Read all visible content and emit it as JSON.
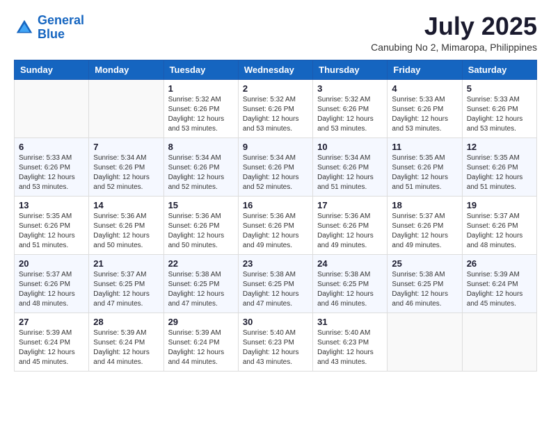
{
  "header": {
    "logo_line1": "General",
    "logo_line2": "Blue",
    "month_year": "July 2025",
    "location": "Canubing No 2, Mimaropa, Philippines"
  },
  "weekdays": [
    "Sunday",
    "Monday",
    "Tuesday",
    "Wednesday",
    "Thursday",
    "Friday",
    "Saturday"
  ],
  "weeks": [
    [
      {
        "day": "",
        "sunrise": "",
        "sunset": "",
        "daylight": ""
      },
      {
        "day": "",
        "sunrise": "",
        "sunset": "",
        "daylight": ""
      },
      {
        "day": "1",
        "sunrise": "Sunrise: 5:32 AM",
        "sunset": "Sunset: 6:26 PM",
        "daylight": "Daylight: 12 hours and 53 minutes."
      },
      {
        "day": "2",
        "sunrise": "Sunrise: 5:32 AM",
        "sunset": "Sunset: 6:26 PM",
        "daylight": "Daylight: 12 hours and 53 minutes."
      },
      {
        "day": "3",
        "sunrise": "Sunrise: 5:32 AM",
        "sunset": "Sunset: 6:26 PM",
        "daylight": "Daylight: 12 hours and 53 minutes."
      },
      {
        "day": "4",
        "sunrise": "Sunrise: 5:33 AM",
        "sunset": "Sunset: 6:26 PM",
        "daylight": "Daylight: 12 hours and 53 minutes."
      },
      {
        "day": "5",
        "sunrise": "Sunrise: 5:33 AM",
        "sunset": "Sunset: 6:26 PM",
        "daylight": "Daylight: 12 hours and 53 minutes."
      }
    ],
    [
      {
        "day": "6",
        "sunrise": "Sunrise: 5:33 AM",
        "sunset": "Sunset: 6:26 PM",
        "daylight": "Daylight: 12 hours and 53 minutes."
      },
      {
        "day": "7",
        "sunrise": "Sunrise: 5:34 AM",
        "sunset": "Sunset: 6:26 PM",
        "daylight": "Daylight: 12 hours and 52 minutes."
      },
      {
        "day": "8",
        "sunrise": "Sunrise: 5:34 AM",
        "sunset": "Sunset: 6:26 PM",
        "daylight": "Daylight: 12 hours and 52 minutes."
      },
      {
        "day": "9",
        "sunrise": "Sunrise: 5:34 AM",
        "sunset": "Sunset: 6:26 PM",
        "daylight": "Daylight: 12 hours and 52 minutes."
      },
      {
        "day": "10",
        "sunrise": "Sunrise: 5:34 AM",
        "sunset": "Sunset: 6:26 PM",
        "daylight": "Daylight: 12 hours and 51 minutes."
      },
      {
        "day": "11",
        "sunrise": "Sunrise: 5:35 AM",
        "sunset": "Sunset: 6:26 PM",
        "daylight": "Daylight: 12 hours and 51 minutes."
      },
      {
        "day": "12",
        "sunrise": "Sunrise: 5:35 AM",
        "sunset": "Sunset: 6:26 PM",
        "daylight": "Daylight: 12 hours and 51 minutes."
      }
    ],
    [
      {
        "day": "13",
        "sunrise": "Sunrise: 5:35 AM",
        "sunset": "Sunset: 6:26 PM",
        "daylight": "Daylight: 12 hours and 51 minutes."
      },
      {
        "day": "14",
        "sunrise": "Sunrise: 5:36 AM",
        "sunset": "Sunset: 6:26 PM",
        "daylight": "Daylight: 12 hours and 50 minutes."
      },
      {
        "day": "15",
        "sunrise": "Sunrise: 5:36 AM",
        "sunset": "Sunset: 6:26 PM",
        "daylight": "Daylight: 12 hours and 50 minutes."
      },
      {
        "day": "16",
        "sunrise": "Sunrise: 5:36 AM",
        "sunset": "Sunset: 6:26 PM",
        "daylight": "Daylight: 12 hours and 49 minutes."
      },
      {
        "day": "17",
        "sunrise": "Sunrise: 5:36 AM",
        "sunset": "Sunset: 6:26 PM",
        "daylight": "Daylight: 12 hours and 49 minutes."
      },
      {
        "day": "18",
        "sunrise": "Sunrise: 5:37 AM",
        "sunset": "Sunset: 6:26 PM",
        "daylight": "Daylight: 12 hours and 49 minutes."
      },
      {
        "day": "19",
        "sunrise": "Sunrise: 5:37 AM",
        "sunset": "Sunset: 6:26 PM",
        "daylight": "Daylight: 12 hours and 48 minutes."
      }
    ],
    [
      {
        "day": "20",
        "sunrise": "Sunrise: 5:37 AM",
        "sunset": "Sunset: 6:26 PM",
        "daylight": "Daylight: 12 hours and 48 minutes."
      },
      {
        "day": "21",
        "sunrise": "Sunrise: 5:37 AM",
        "sunset": "Sunset: 6:25 PM",
        "daylight": "Daylight: 12 hours and 47 minutes."
      },
      {
        "day": "22",
        "sunrise": "Sunrise: 5:38 AM",
        "sunset": "Sunset: 6:25 PM",
        "daylight": "Daylight: 12 hours and 47 minutes."
      },
      {
        "day": "23",
        "sunrise": "Sunrise: 5:38 AM",
        "sunset": "Sunset: 6:25 PM",
        "daylight": "Daylight: 12 hours and 47 minutes."
      },
      {
        "day": "24",
        "sunrise": "Sunrise: 5:38 AM",
        "sunset": "Sunset: 6:25 PM",
        "daylight": "Daylight: 12 hours and 46 minutes."
      },
      {
        "day": "25",
        "sunrise": "Sunrise: 5:38 AM",
        "sunset": "Sunset: 6:25 PM",
        "daylight": "Daylight: 12 hours and 46 minutes."
      },
      {
        "day": "26",
        "sunrise": "Sunrise: 5:39 AM",
        "sunset": "Sunset: 6:24 PM",
        "daylight": "Daylight: 12 hours and 45 minutes."
      }
    ],
    [
      {
        "day": "27",
        "sunrise": "Sunrise: 5:39 AM",
        "sunset": "Sunset: 6:24 PM",
        "daylight": "Daylight: 12 hours and 45 minutes."
      },
      {
        "day": "28",
        "sunrise": "Sunrise: 5:39 AM",
        "sunset": "Sunset: 6:24 PM",
        "daylight": "Daylight: 12 hours and 44 minutes."
      },
      {
        "day": "29",
        "sunrise": "Sunrise: 5:39 AM",
        "sunset": "Sunset: 6:24 PM",
        "daylight": "Daylight: 12 hours and 44 minutes."
      },
      {
        "day": "30",
        "sunrise": "Sunrise: 5:40 AM",
        "sunset": "Sunset: 6:23 PM",
        "daylight": "Daylight: 12 hours and 43 minutes."
      },
      {
        "day": "31",
        "sunrise": "Sunrise: 5:40 AM",
        "sunset": "Sunset: 6:23 PM",
        "daylight": "Daylight: 12 hours and 43 minutes."
      },
      {
        "day": "",
        "sunrise": "",
        "sunset": "",
        "daylight": ""
      },
      {
        "day": "",
        "sunrise": "",
        "sunset": "",
        "daylight": ""
      }
    ]
  ]
}
